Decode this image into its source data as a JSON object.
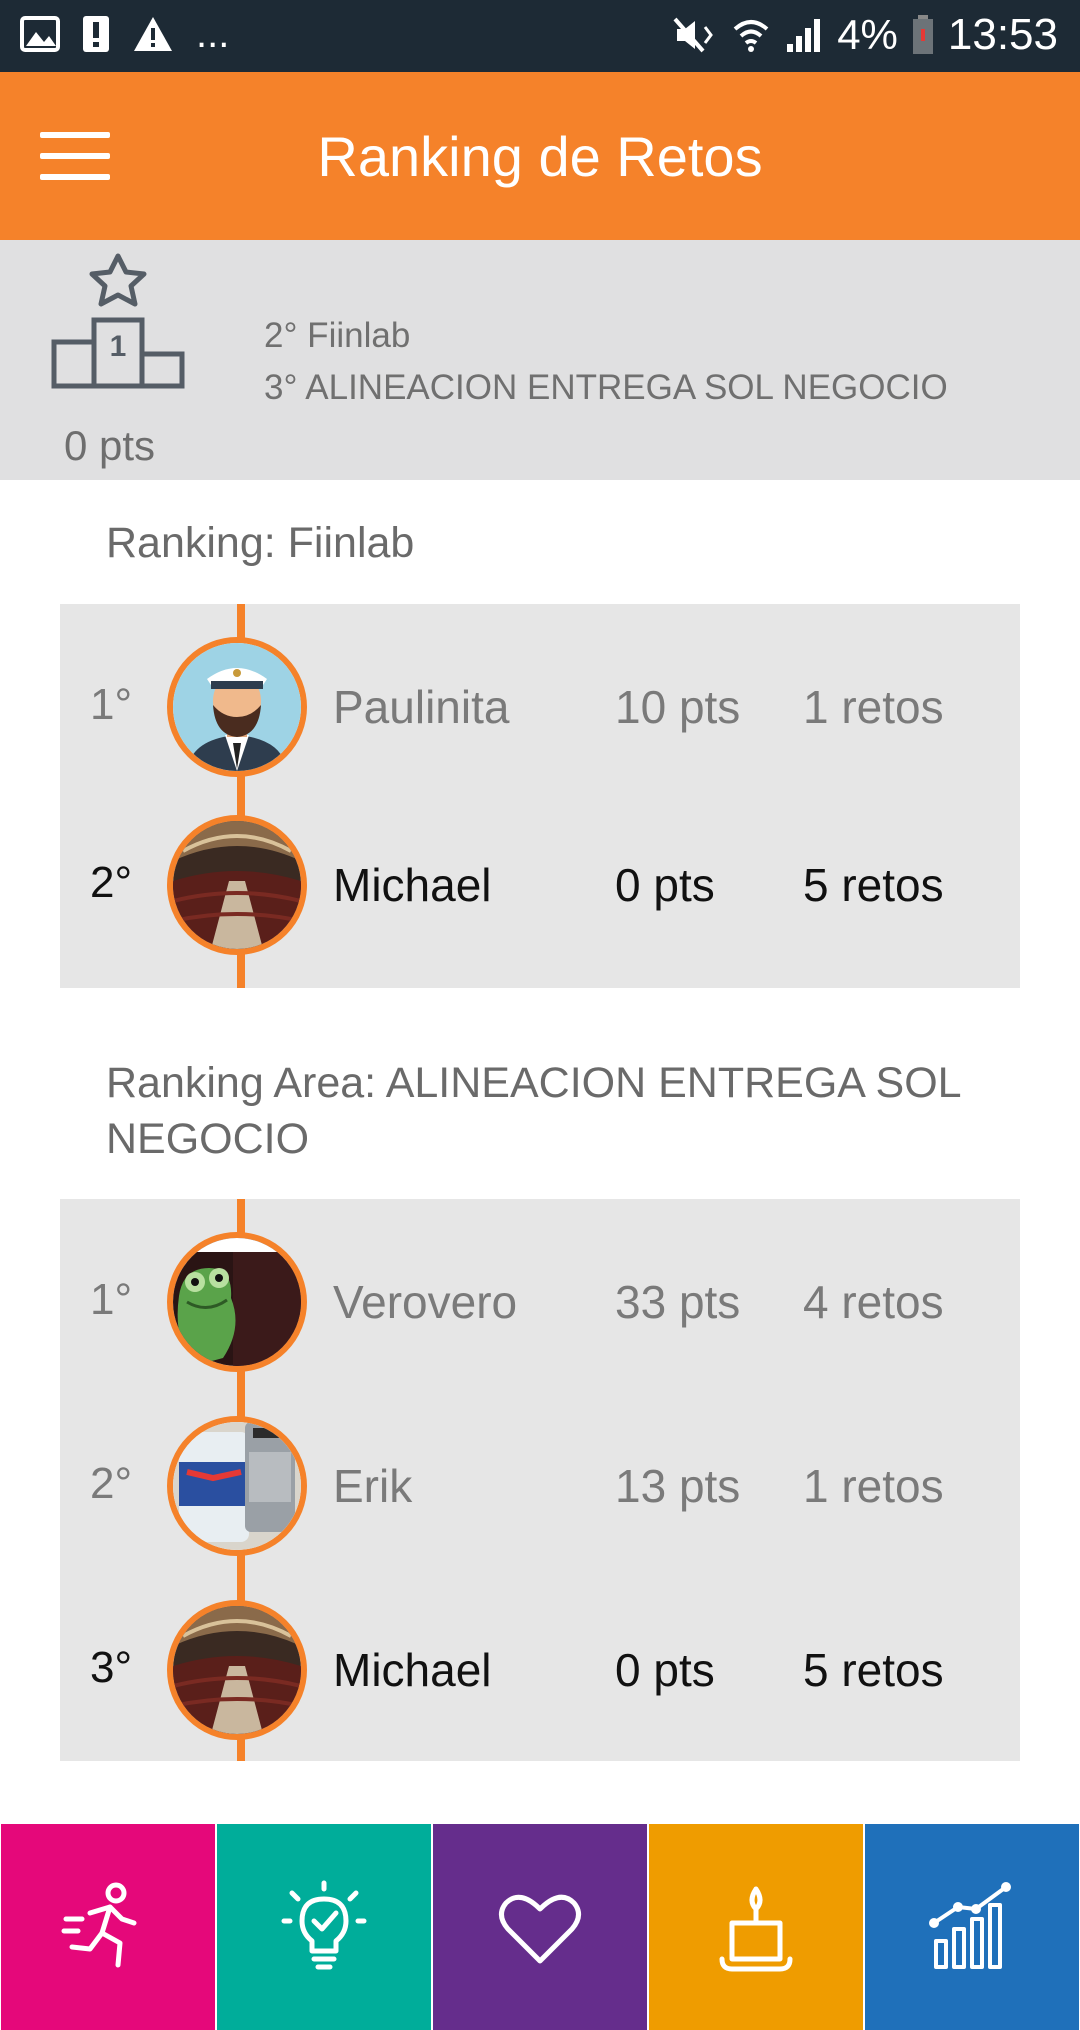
{
  "status_bar": {
    "battery": "4%",
    "time": "13:53",
    "more": "..."
  },
  "app_bar": {
    "title": "Ranking de Retos"
  },
  "summary": {
    "points": "0 pts",
    "podium_rank": "1",
    "lines": [
      "2° Fiinlab",
      "3° ALINEACION ENTREGA SOL NEGOCIO"
    ]
  },
  "sections": [
    {
      "title": "Ranking: Fiinlab",
      "rows": [
        {
          "rank": "1°",
          "name": "Paulinita",
          "pts": "10 pts",
          "retos": "1 retos",
          "highlight": false,
          "avatar": "captain-avatar"
        },
        {
          "rank": "2°",
          "name": "Michael",
          "pts": "0 pts",
          "retos": "5 retos",
          "highlight": true,
          "avatar": "theater-photo"
        }
      ]
    },
    {
      "title": "Ranking Area: ALINEACION ENTREGA SOL NEGOCIO",
      "rows": [
        {
          "rank": "1°",
          "name": "Verovero",
          "pts": "33 pts",
          "retos": "4 retos",
          "highlight": false,
          "avatar": "frog-photo"
        },
        {
          "rank": "2°",
          "name": "Erik",
          "pts": "13 pts",
          "retos": "1 retos",
          "highlight": false,
          "avatar": "cans-photo"
        },
        {
          "rank": "3°",
          "name": "Michael",
          "pts": "0 pts",
          "retos": "5 retos",
          "highlight": true,
          "avatar": "theater-photo"
        }
      ]
    }
  ],
  "bottom_nav": [
    {
      "icon": "running-person-icon",
      "color": "#e5087a"
    },
    {
      "icon": "lightbulb-check-icon",
      "color": "#00ad9a"
    },
    {
      "icon": "heart-icon",
      "color": "#652d8c"
    },
    {
      "icon": "candle-icon",
      "color": "#ef9c00"
    },
    {
      "icon": "growth-chart-icon",
      "color": "#1f70ba"
    }
  ],
  "colors": {
    "accent": "#f5822a",
    "statusbar": "#1d2a35",
    "card_bg": "#e6e6e6",
    "summary_bg": "#e0e0e1"
  }
}
